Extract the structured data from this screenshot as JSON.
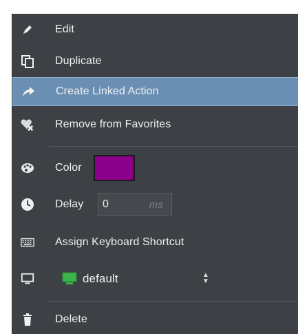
{
  "menu": {
    "items": [
      {
        "id": "edit",
        "label": "Edit",
        "icon": "pencil-icon"
      },
      {
        "id": "duplicate",
        "label": "Duplicate",
        "icon": "duplicate-icon"
      },
      {
        "id": "create-linked-action",
        "label": "Create Linked Action",
        "icon": "share-arrow-icon",
        "highlighted": true
      },
      {
        "id": "remove-favorites",
        "label": "Remove from Favorites",
        "icon": "heart-remove-icon"
      },
      {
        "id": "color",
        "label": "Color",
        "icon": "palette-icon",
        "swatch_color": "#8b008b"
      },
      {
        "id": "delay",
        "label": "Delay",
        "icon": "clock-icon",
        "value": "0",
        "unit": "ms"
      },
      {
        "id": "shortcut",
        "label": "Assign Keyboard Shortcut",
        "icon": "keyboard-icon"
      },
      {
        "id": "monitor",
        "icon": "monitor-icon",
        "select_value": "default",
        "select_icon": "green-monitor-icon"
      },
      {
        "id": "delete",
        "label": "Delete",
        "icon": "trash-icon"
      }
    ]
  },
  "colors": {
    "menu_bg": "#3d4044",
    "highlight_bg": "#6a8fb3",
    "text": "#eef0f2",
    "accent_green": "#39b54a"
  }
}
